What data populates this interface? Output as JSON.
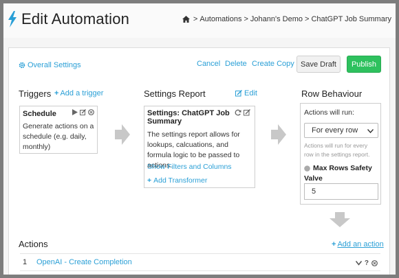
{
  "header": {
    "title": "Edit Automation",
    "breadcrumbs": [
      "Automations",
      "Johann's Demo",
      "ChatGPT Job Summary"
    ],
    "separator": ">"
  },
  "toolbar": {
    "overall_settings": "Overall Settings",
    "cancel": "Cancel",
    "delete": "Delete",
    "create_copy": "Create Copy",
    "save_draft": "Save Draft",
    "publish": "Publish"
  },
  "triggers": {
    "title": "Triggers",
    "add_label": "Add a trigger",
    "card_title": "Schedule",
    "card_text": "Generate actions on a schedule (e.g. daily, monthly)"
  },
  "settings_report": {
    "title": "Settings Report",
    "edit_label": "Edit",
    "card_title_line1": "Settings: ChatGPT Job",
    "card_title_line2": "Summary",
    "card_text": "The settings report allows for lookups, calcuations, and formula logic to be passed to actions.",
    "show_filters": "Show Filters and Columns",
    "add_transformer": "Add Transformer"
  },
  "row_behaviour": {
    "title": "Row Behaviour",
    "run_label": "Actions will run:",
    "run_value": "For every row",
    "hint": "Actions will run for every row in the settings report.",
    "max_rows_label_line1": "Max Rows Safety",
    "max_rows_label_line2": "Valve",
    "max_rows_value": "5"
  },
  "actions": {
    "title": "Actions",
    "add_label": "Add an action",
    "items": [
      {
        "index": "1",
        "label": "OpenAI - Create Completion",
        "help": "?"
      }
    ]
  },
  "colors": {
    "accent": "#2a9fd6",
    "publish": "#2ec15e",
    "bolt": "#2a9fd6"
  }
}
